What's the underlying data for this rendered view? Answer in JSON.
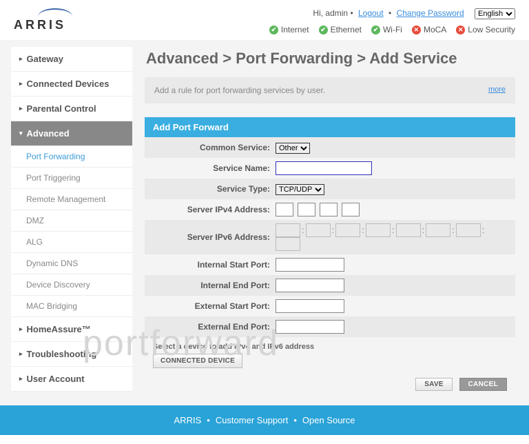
{
  "header": {
    "logo": "ARRIS",
    "greeting": "Hi, admin",
    "logout": "Logout",
    "change_password": "Change Password",
    "language": "English",
    "status": [
      {
        "label": "Internet",
        "ok": true
      },
      {
        "label": "Ethernet",
        "ok": true
      },
      {
        "label": "Wi-Fi",
        "ok": true
      },
      {
        "label": "MoCA",
        "ok": false
      },
      {
        "label": "Low Security",
        "ok": false
      }
    ]
  },
  "sidebar": {
    "items": [
      {
        "label": "Gateway",
        "active": false,
        "sub": null
      },
      {
        "label": "Connected Devices",
        "active": false,
        "sub": null
      },
      {
        "label": "Parental Control",
        "active": false,
        "sub": null
      },
      {
        "label": "Advanced",
        "active": true,
        "sub": [
          {
            "label": "Port Forwarding",
            "active": true
          },
          {
            "label": "Port Triggering",
            "active": false
          },
          {
            "label": "Remote Management",
            "active": false
          },
          {
            "label": "DMZ",
            "active": false
          },
          {
            "label": "ALG",
            "active": false
          },
          {
            "label": "Dynamic DNS",
            "active": false
          },
          {
            "label": "Device Discovery",
            "active": false
          },
          {
            "label": "MAC Bridging",
            "active": false
          }
        ]
      },
      {
        "label": "HomeAssure™",
        "active": false,
        "sub": null
      },
      {
        "label": "Troubleshooting",
        "active": false,
        "sub": null
      },
      {
        "label": "User Account",
        "active": false,
        "sub": null
      }
    ]
  },
  "main": {
    "title": "Advanced > Port Forwarding > Add Service",
    "info": "Add a rule for port forwarding services by user.",
    "more": "more",
    "panel_head": "Add Port Forward",
    "rows": {
      "common_service": {
        "label": "Common Service:",
        "value": "Other"
      },
      "service_name": {
        "label": "Service Name:",
        "value": ""
      },
      "service_type": {
        "label": "Service Type:",
        "value": "TCP/UDP"
      },
      "ipv4": {
        "label": "Server IPv4 Address:"
      },
      "ipv6": {
        "label": "Server IPv6 Address:"
      },
      "int_start": {
        "label": "Internal Start Port:",
        "value": ""
      },
      "int_end": {
        "label": "Internal End Port:",
        "value": ""
      },
      "ext_start": {
        "label": "External Start Port:",
        "value": ""
      },
      "ext_end": {
        "label": "External End Port:",
        "value": ""
      }
    },
    "select_device": "Select a device to add IPv4 and IPv6 address",
    "connected_device": "CONNECTED DEVICE",
    "save": "SAVE",
    "cancel": "CANCEL"
  },
  "footer": {
    "a": "ARRIS",
    "b": "Customer Support",
    "c": "Open Source"
  },
  "watermark": "portforward"
}
